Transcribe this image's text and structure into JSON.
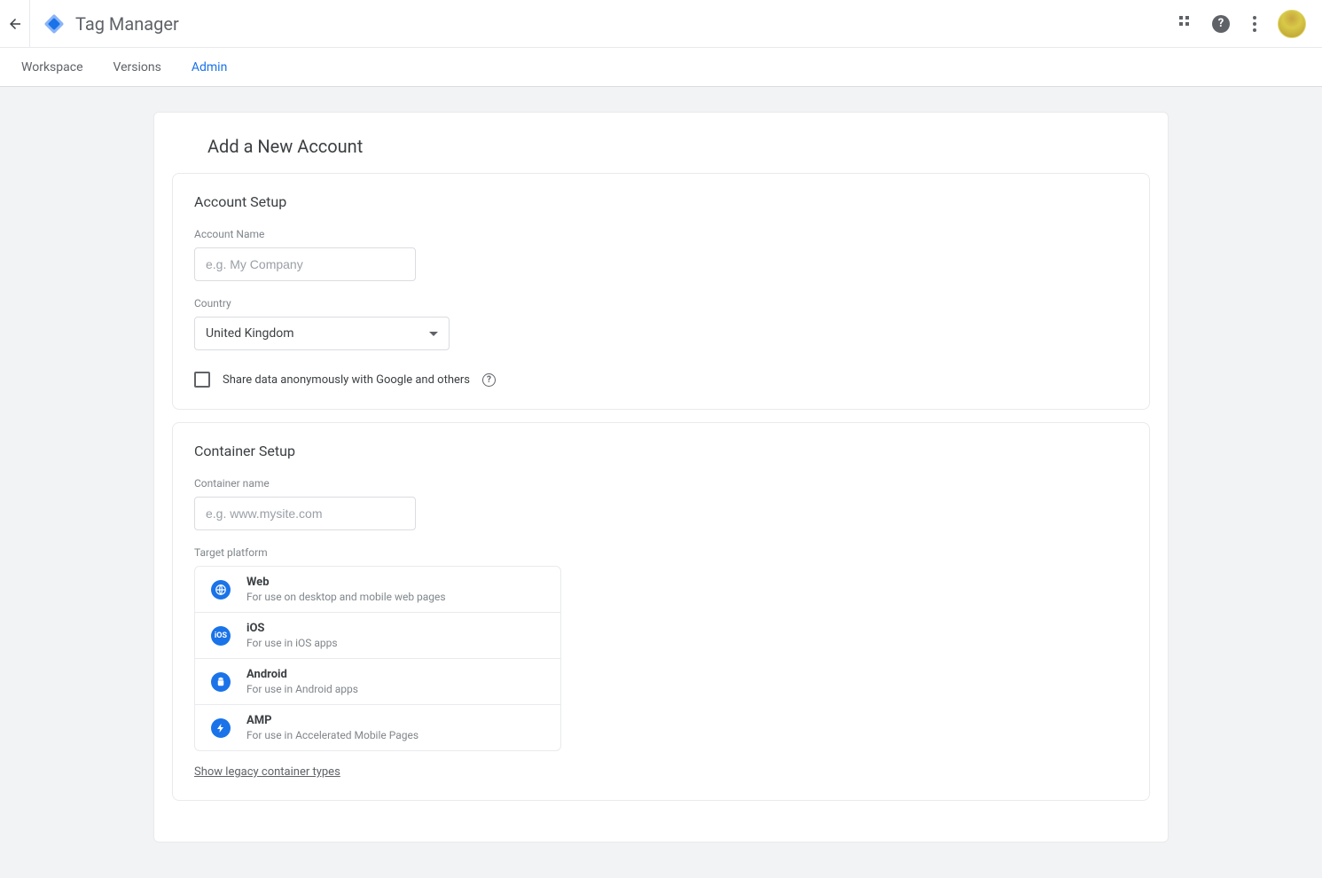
{
  "header": {
    "app_title": "Tag Manager"
  },
  "tabs": {
    "workspace": "Workspace",
    "versions": "Versions",
    "admin": "Admin"
  },
  "page": {
    "title": "Add a New Account"
  },
  "account_setup": {
    "heading": "Account Setup",
    "account_name_label": "Account Name",
    "account_name_placeholder": "e.g. My Company",
    "account_name_value": "",
    "country_label": "Country",
    "country_value": "United Kingdom",
    "share_label": "Share data anonymously with Google and others"
  },
  "container_setup": {
    "heading": "Container Setup",
    "container_name_label": "Container name",
    "container_name_placeholder": "e.g. www.mysite.com",
    "container_name_value": "",
    "target_platform_label": "Target platform",
    "platforms": [
      {
        "title": "Web",
        "desc": "For use on desktop and mobile web pages",
        "icon": "globe"
      },
      {
        "title": "iOS",
        "desc": "For use in iOS apps",
        "icon": "ios"
      },
      {
        "title": "Android",
        "desc": "For use in Android apps",
        "icon": "android"
      },
      {
        "title": "AMP",
        "desc": "For use in Accelerated Mobile Pages",
        "icon": "bolt"
      }
    ],
    "legacy_link": "Show legacy container types"
  }
}
